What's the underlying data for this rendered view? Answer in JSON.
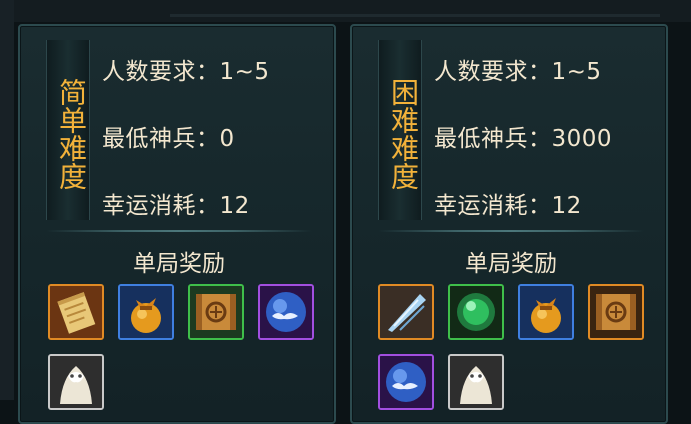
{
  "panels": [
    {
      "difficulty_label": "简单难度",
      "player_req": "人数要求：1~5",
      "min_power": "最低神兵：0",
      "cost": "幸运消耗：12",
      "reward_title": "单局奖励",
      "rewards": [
        {
          "icon": "scroll-icon",
          "quality": "orange"
        },
        {
          "icon": "treasure-bag-icon",
          "quality": "blue"
        },
        {
          "icon": "rune-scroll-icon",
          "quality": "green"
        },
        {
          "icon": "cloud-orb-icon",
          "quality": "purple"
        },
        {
          "icon": "white-beast-icon",
          "quality": "white"
        }
      ]
    },
    {
      "difficulty_label": "困难难度",
      "player_req": "人数要求：1~5",
      "min_power": "最低神兵：3000",
      "cost": "幸运消耗：12",
      "reward_title": "单局奖励",
      "rewards": [
        {
          "icon": "feather-blade-icon",
          "quality": "orange"
        },
        {
          "icon": "green-orb-icon",
          "quality": "green"
        },
        {
          "icon": "treasure-bag-icon",
          "quality": "blue"
        },
        {
          "icon": "rune-scroll-icon",
          "quality": "orange"
        },
        {
          "icon": "cloud-orb-icon",
          "quality": "purple"
        },
        {
          "icon": "white-beast-icon",
          "quality": "white"
        }
      ]
    }
  ],
  "colors": {
    "difficulty_text": "#f2b23a",
    "body_text": "#f3e7cf",
    "panel_border": "#2c4a4e"
  }
}
